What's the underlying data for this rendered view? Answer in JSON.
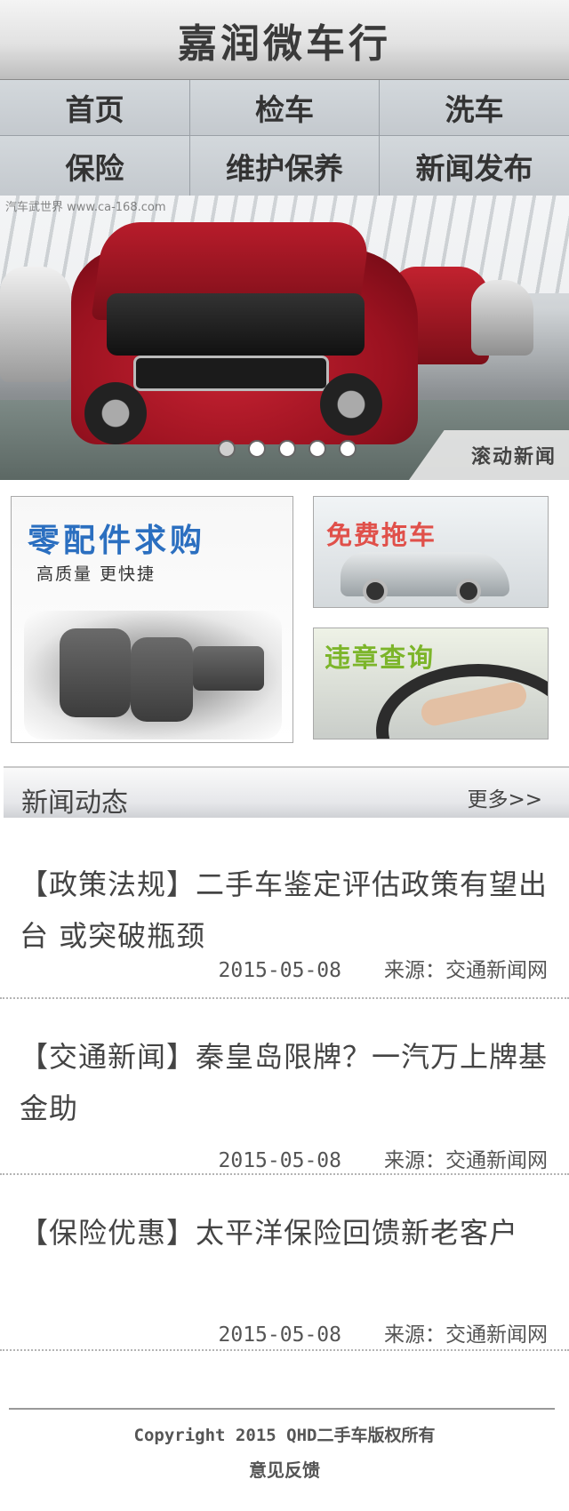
{
  "header": {
    "title": "嘉润微车行"
  },
  "nav": {
    "items": [
      {
        "label": "首页"
      },
      {
        "label": "检车"
      },
      {
        "label": "洗车"
      },
      {
        "label": "保险"
      },
      {
        "label": "维护保养"
      },
      {
        "label": "新闻发布"
      }
    ]
  },
  "banner": {
    "watermark": "汽车武世界 www.ca-168.com",
    "caption": "滚动新闻",
    "slide_count": 5,
    "active_slide": 1
  },
  "features": {
    "parts": {
      "title": "零配件求购",
      "subtitle": "高质量  更快捷"
    },
    "tow": {
      "title": "免费拖车"
    },
    "violation": {
      "title": "违章查询"
    }
  },
  "news": {
    "section_title": "新闻动态",
    "more_label": "更多>>",
    "items": [
      {
        "title": "【政策法规】二手车鉴定评估政策有望出台 或突破瓶颈",
        "date": "2015-05-08",
        "source": "来源：交通新闻网"
      },
      {
        "title": "【交通新闻】秦皇岛限牌？一汽万上牌基金助",
        "date": "2015-05-08",
        "source": "来源：交通新闻网"
      },
      {
        "title": "【保险优惠】太平洋保险回馈新老客户",
        "date": "2015-05-08",
        "source": "来源：交通新闻网"
      }
    ]
  },
  "footer": {
    "copyright": "Copyright  2015 QHD二手车版权所有",
    "feedback": "意见反馈"
  },
  "colors": {
    "parts_title": "#2b6fc0",
    "tow_title": "#e0504a",
    "violation_title": "#7cb52a",
    "nav_bg": "#c9ced3"
  }
}
